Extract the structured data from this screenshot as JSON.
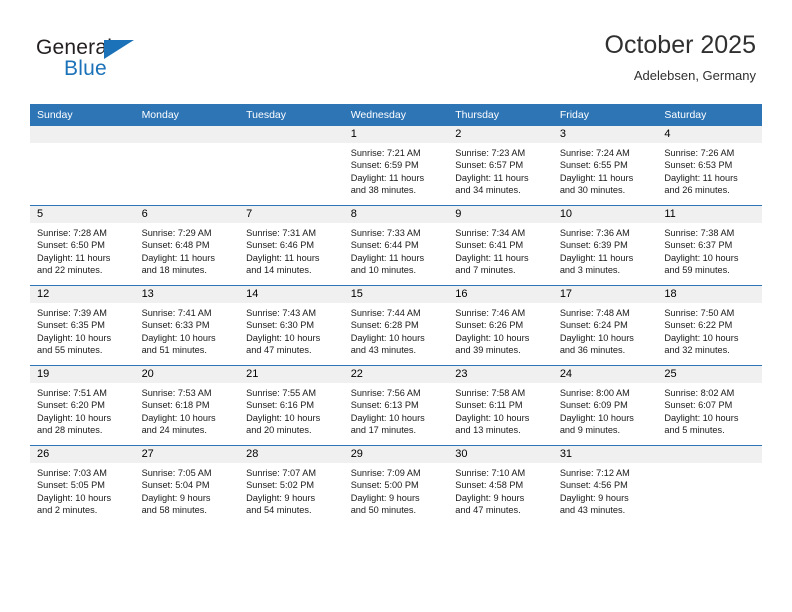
{
  "brand": {
    "name_top": "General",
    "name_bottom": "Blue",
    "accent_color": "#1b72b8"
  },
  "header": {
    "title": "October 2025",
    "subtitle": "Adelebsen, Germany"
  },
  "theme": {
    "header_row_bg": "#2e75b6",
    "daynum_band_bg": "#f0f0f0",
    "grid_line": "#2e75b6",
    "text": "#000000"
  },
  "calendar": {
    "weekday_headers": [
      "Sunday",
      "Monday",
      "Tuesday",
      "Wednesday",
      "Thursday",
      "Friday",
      "Saturday"
    ],
    "weeks": [
      [
        {
          "day": "",
          "empty": true,
          "lines": []
        },
        {
          "day": "",
          "empty": true,
          "lines": []
        },
        {
          "day": "",
          "empty": true,
          "lines": []
        },
        {
          "day": "1",
          "empty": false,
          "lines": [
            "Sunrise: 7:21 AM",
            "Sunset: 6:59 PM",
            "Daylight: 11 hours",
            "and 38 minutes."
          ]
        },
        {
          "day": "2",
          "empty": false,
          "lines": [
            "Sunrise: 7:23 AM",
            "Sunset: 6:57 PM",
            "Daylight: 11 hours",
            "and 34 minutes."
          ]
        },
        {
          "day": "3",
          "empty": false,
          "lines": [
            "Sunrise: 7:24 AM",
            "Sunset: 6:55 PM",
            "Daylight: 11 hours",
            "and 30 minutes."
          ]
        },
        {
          "day": "4",
          "empty": false,
          "lines": [
            "Sunrise: 7:26 AM",
            "Sunset: 6:53 PM",
            "Daylight: 11 hours",
            "and 26 minutes."
          ]
        }
      ],
      [
        {
          "day": "5",
          "empty": false,
          "lines": [
            "Sunrise: 7:28 AM",
            "Sunset: 6:50 PM",
            "Daylight: 11 hours",
            "and 22 minutes."
          ]
        },
        {
          "day": "6",
          "empty": false,
          "lines": [
            "Sunrise: 7:29 AM",
            "Sunset: 6:48 PM",
            "Daylight: 11 hours",
            "and 18 minutes."
          ]
        },
        {
          "day": "7",
          "empty": false,
          "lines": [
            "Sunrise: 7:31 AM",
            "Sunset: 6:46 PM",
            "Daylight: 11 hours",
            "and 14 minutes."
          ]
        },
        {
          "day": "8",
          "empty": false,
          "lines": [
            "Sunrise: 7:33 AM",
            "Sunset: 6:44 PM",
            "Daylight: 11 hours",
            "and 10 minutes."
          ]
        },
        {
          "day": "9",
          "empty": false,
          "lines": [
            "Sunrise: 7:34 AM",
            "Sunset: 6:41 PM",
            "Daylight: 11 hours",
            "and 7 minutes."
          ]
        },
        {
          "day": "10",
          "empty": false,
          "lines": [
            "Sunrise: 7:36 AM",
            "Sunset: 6:39 PM",
            "Daylight: 11 hours",
            "and 3 minutes."
          ]
        },
        {
          "day": "11",
          "empty": false,
          "lines": [
            "Sunrise: 7:38 AM",
            "Sunset: 6:37 PM",
            "Daylight: 10 hours",
            "and 59 minutes."
          ]
        }
      ],
      [
        {
          "day": "12",
          "empty": false,
          "lines": [
            "Sunrise: 7:39 AM",
            "Sunset: 6:35 PM",
            "Daylight: 10 hours",
            "and 55 minutes."
          ]
        },
        {
          "day": "13",
          "empty": false,
          "lines": [
            "Sunrise: 7:41 AM",
            "Sunset: 6:33 PM",
            "Daylight: 10 hours",
            "and 51 minutes."
          ]
        },
        {
          "day": "14",
          "empty": false,
          "lines": [
            "Sunrise: 7:43 AM",
            "Sunset: 6:30 PM",
            "Daylight: 10 hours",
            "and 47 minutes."
          ]
        },
        {
          "day": "15",
          "empty": false,
          "lines": [
            "Sunrise: 7:44 AM",
            "Sunset: 6:28 PM",
            "Daylight: 10 hours",
            "and 43 minutes."
          ]
        },
        {
          "day": "16",
          "empty": false,
          "lines": [
            "Sunrise: 7:46 AM",
            "Sunset: 6:26 PM",
            "Daylight: 10 hours",
            "and 39 minutes."
          ]
        },
        {
          "day": "17",
          "empty": false,
          "lines": [
            "Sunrise: 7:48 AM",
            "Sunset: 6:24 PM",
            "Daylight: 10 hours",
            "and 36 minutes."
          ]
        },
        {
          "day": "18",
          "empty": false,
          "lines": [
            "Sunrise: 7:50 AM",
            "Sunset: 6:22 PM",
            "Daylight: 10 hours",
            "and 32 minutes."
          ]
        }
      ],
      [
        {
          "day": "19",
          "empty": false,
          "lines": [
            "Sunrise: 7:51 AM",
            "Sunset: 6:20 PM",
            "Daylight: 10 hours",
            "and 28 minutes."
          ]
        },
        {
          "day": "20",
          "empty": false,
          "lines": [
            "Sunrise: 7:53 AM",
            "Sunset: 6:18 PM",
            "Daylight: 10 hours",
            "and 24 minutes."
          ]
        },
        {
          "day": "21",
          "empty": false,
          "lines": [
            "Sunrise: 7:55 AM",
            "Sunset: 6:16 PM",
            "Daylight: 10 hours",
            "and 20 minutes."
          ]
        },
        {
          "day": "22",
          "empty": false,
          "lines": [
            "Sunrise: 7:56 AM",
            "Sunset: 6:13 PM",
            "Daylight: 10 hours",
            "and 17 minutes."
          ]
        },
        {
          "day": "23",
          "empty": false,
          "lines": [
            "Sunrise: 7:58 AM",
            "Sunset: 6:11 PM",
            "Daylight: 10 hours",
            "and 13 minutes."
          ]
        },
        {
          "day": "24",
          "empty": false,
          "lines": [
            "Sunrise: 8:00 AM",
            "Sunset: 6:09 PM",
            "Daylight: 10 hours",
            "and 9 minutes."
          ]
        },
        {
          "day": "25",
          "empty": false,
          "lines": [
            "Sunrise: 8:02 AM",
            "Sunset: 6:07 PM",
            "Daylight: 10 hours",
            "and 5 minutes."
          ]
        }
      ],
      [
        {
          "day": "26",
          "empty": false,
          "lines": [
            "Sunrise: 7:03 AM",
            "Sunset: 5:05 PM",
            "Daylight: 10 hours",
            "and 2 minutes."
          ]
        },
        {
          "day": "27",
          "empty": false,
          "lines": [
            "Sunrise: 7:05 AM",
            "Sunset: 5:04 PM",
            "Daylight: 9 hours",
            "and 58 minutes."
          ]
        },
        {
          "day": "28",
          "empty": false,
          "lines": [
            "Sunrise: 7:07 AM",
            "Sunset: 5:02 PM",
            "Daylight: 9 hours",
            "and 54 minutes."
          ]
        },
        {
          "day": "29",
          "empty": false,
          "lines": [
            "Sunrise: 7:09 AM",
            "Sunset: 5:00 PM",
            "Daylight: 9 hours",
            "and 50 minutes."
          ]
        },
        {
          "day": "30",
          "empty": false,
          "lines": [
            "Sunrise: 7:10 AM",
            "Sunset: 4:58 PM",
            "Daylight: 9 hours",
            "and 47 minutes."
          ]
        },
        {
          "day": "31",
          "empty": false,
          "lines": [
            "Sunrise: 7:12 AM",
            "Sunset: 4:56 PM",
            "Daylight: 9 hours",
            "and 43 minutes."
          ]
        },
        {
          "day": "",
          "empty": true,
          "lines": []
        }
      ]
    ]
  }
}
